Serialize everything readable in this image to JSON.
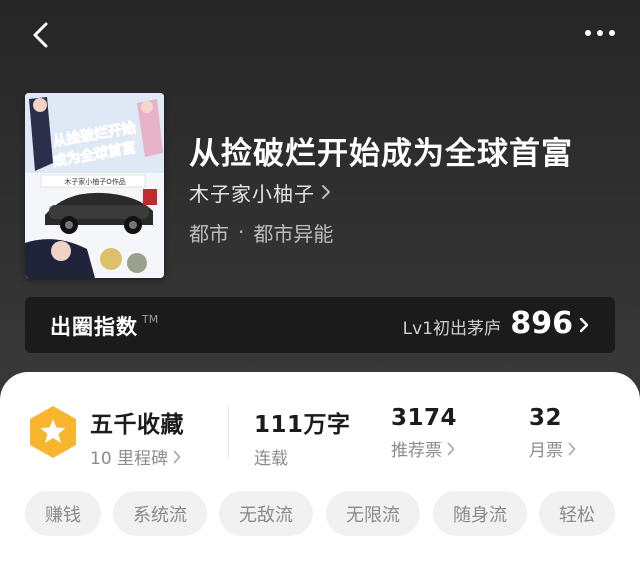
{
  "header": {
    "back_icon": "chevron-left-icon",
    "more_icon": "more-horizontal-icon"
  },
  "book": {
    "title": "从捡破烂开始成为全球首富",
    "author": "木子家小柚子",
    "genres": [
      "都市",
      "都市异能"
    ],
    "genre_separator": "·",
    "cover": {
      "title_line1": "从捡破烂开始",
      "title_line2": "成为全球首富",
      "credit": "木子家小柚子O作品"
    }
  },
  "influence": {
    "label": "出圈指数",
    "trademark": "TM",
    "level": "Lv1初出茅庐",
    "score": "896"
  },
  "stats": {
    "collection": {
      "value": "五千收藏",
      "sub": "10 里程碑"
    },
    "words": {
      "value": "111万字",
      "sub": "连载"
    },
    "recommend": {
      "value": "3174",
      "sub": "推荐票"
    },
    "monthly": {
      "value": "32",
      "sub": "月票"
    }
  },
  "tags": [
    "赚钱",
    "系统流",
    "无敌流",
    "无限流",
    "随身流",
    "轻松"
  ],
  "colors": {
    "badge_orange": "#f8b62f",
    "hero_bg": "#2b2b2b",
    "sheet_bg": "#ffffff"
  }
}
